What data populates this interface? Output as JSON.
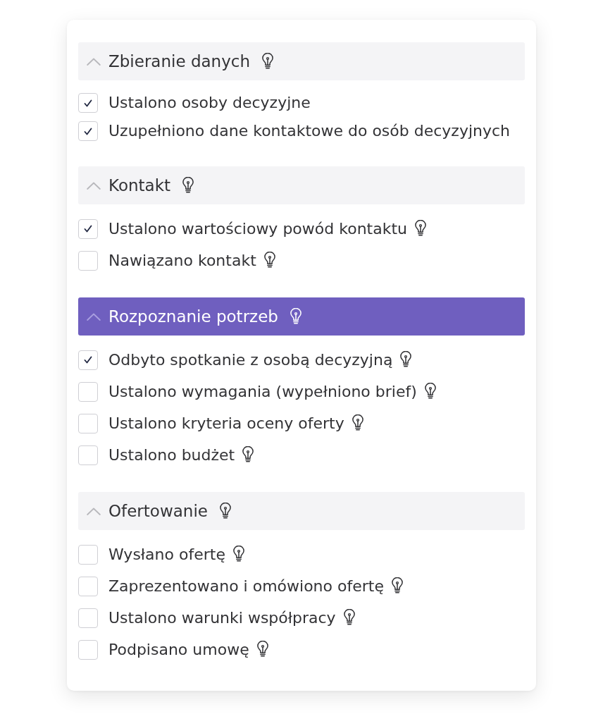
{
  "sections": [
    {
      "title": "Zbieranie danych",
      "selected": false,
      "expanded": true,
      "hint": true,
      "items": [
        {
          "label": "Ustalono osoby decyzyjne",
          "checked": true,
          "hint": false
        },
        {
          "label": "Uzupełniono dane kontaktowe do osób decyzyjnych",
          "checked": true,
          "hint": false
        }
      ]
    },
    {
      "title": "Kontakt",
      "selected": false,
      "expanded": true,
      "hint": true,
      "items": [
        {
          "label": "Ustalono wartościowy powód kontaktu",
          "checked": true,
          "hint": true
        },
        {
          "label": "Nawiązano kontakt",
          "checked": false,
          "hint": true
        }
      ]
    },
    {
      "title": "Rozpoznanie potrzeb",
      "selected": true,
      "expanded": true,
      "hint": true,
      "items": [
        {
          "label": "Odbyto spotkanie z osobą decyzyjną",
          "checked": true,
          "hint": true
        },
        {
          "label": "Ustalono wymagania (wypełniono brief)",
          "checked": false,
          "hint": true
        },
        {
          "label": "Ustalono kryteria oceny oferty",
          "checked": false,
          "hint": true
        },
        {
          "label": "Ustalono budżet",
          "checked": false,
          "hint": true
        }
      ]
    },
    {
      "title": "Ofertowanie",
      "selected": false,
      "expanded": true,
      "hint": true,
      "items": [
        {
          "label": "Wysłano ofertę",
          "checked": false,
          "hint": true
        },
        {
          "label": "Zaprezentowano i omówiono ofertę",
          "checked": false,
          "hint": true
        },
        {
          "label": "Ustalono warunki współpracy",
          "checked": false,
          "hint": true
        },
        {
          "label": "Podpisano umowę",
          "checked": false,
          "hint": true
        }
      ]
    }
  ]
}
